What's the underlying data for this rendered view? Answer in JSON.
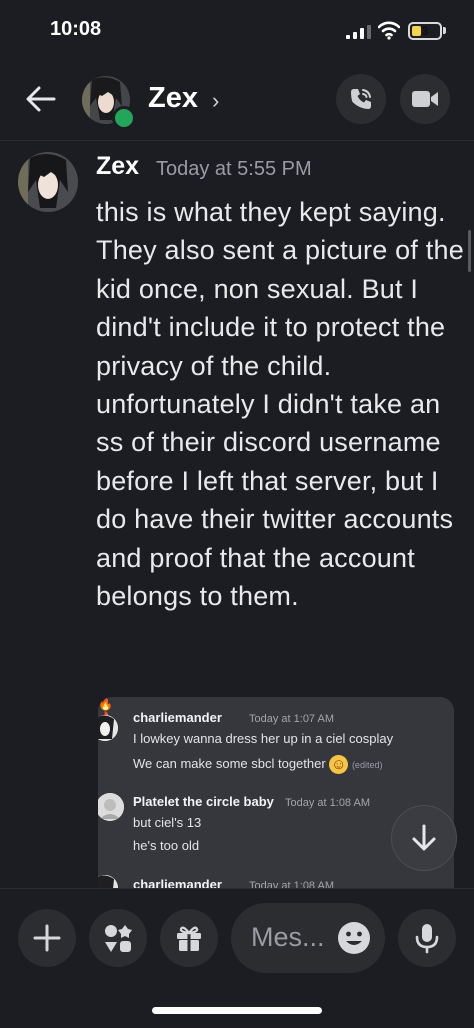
{
  "status_bar": {
    "time": "10:08",
    "battery": "3"
  },
  "header": {
    "name": "Zex",
    "chevron": "›"
  },
  "message": {
    "author": "Zex",
    "timestamp": "Today at 5:55 PM",
    "text": "this is what they kept saying. They also sent a picture of the kid once, non sexual. But I dind't include it to protect the privacy of the child. unfortunately I didn't take an ss of their discord username before I left that server, but I do have their twitter accounts and proof that the account belongs to them."
  },
  "embed": {
    "messages": [
      {
        "author": "charliemander",
        "badge": "🔥",
        "time": "Today at 1:07 AM",
        "lines": [
          "I lowkey wanna dress her up in a ciel cosplay",
          "We can make some sbcl together"
        ],
        "emoji": "☺",
        "edited": "(edited)"
      },
      {
        "author": "Platelet the circle baby",
        "time": "Today at 1:08 AM",
        "lines": [
          "but ciel's 13",
          "he's too old"
        ]
      },
      {
        "author": "charliemander",
        "badge": "🔥",
        "time": "Today at 1:08 AM"
      }
    ]
  },
  "composer": {
    "placeholder": "Mes..."
  },
  "icons": [
    "back-arrow-icon",
    "phone-icon",
    "video-icon",
    "plus-icon",
    "apps-icon",
    "gift-icon",
    "emoji-icon",
    "microphone-icon",
    "arrow-down-icon"
  ]
}
